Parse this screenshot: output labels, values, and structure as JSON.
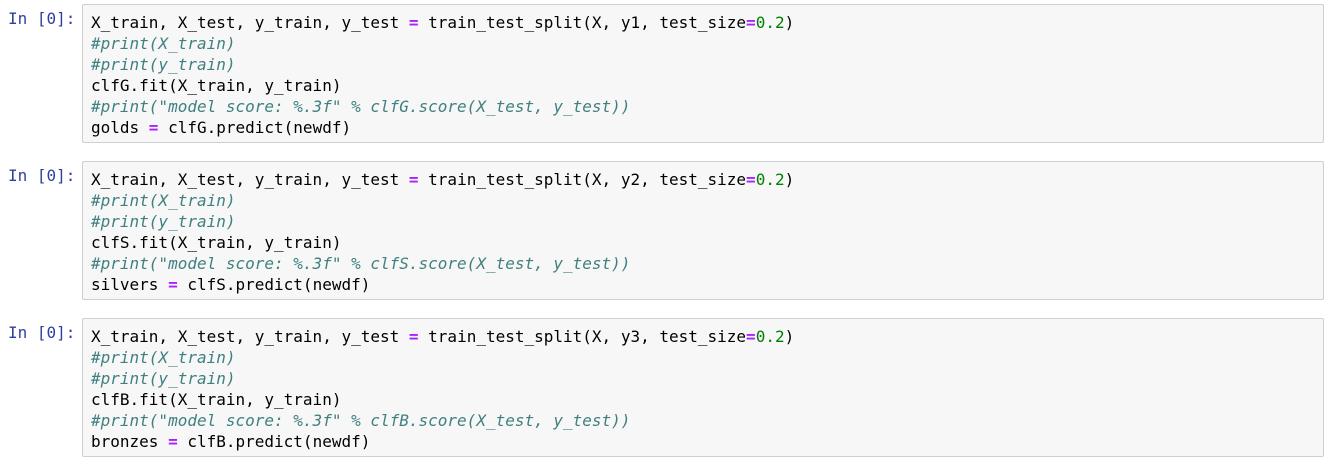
{
  "colors": {
    "prompt": "#303F9F",
    "operator": "#AA22FF",
    "number": "#008000",
    "comment": "#408080",
    "cell_background": "#f7f7f7",
    "cell_border": "#cfcfcf"
  },
  "cells": [
    {
      "prompt": "In [0]:",
      "lines": [
        [
          {
            "t": "plain",
            "text": "X_train, X_test, y_train, y_test "
          },
          {
            "t": "op",
            "text": "="
          },
          {
            "t": "plain",
            "text": " train_test_split(X, y1, test_size"
          },
          {
            "t": "op",
            "text": "="
          },
          {
            "t": "num",
            "text": "0.2"
          },
          {
            "t": "plain",
            "text": ")"
          }
        ],
        [
          {
            "t": "comment",
            "text": "#print(X_train)"
          }
        ],
        [
          {
            "t": "comment",
            "text": "#print(y_train)"
          }
        ],
        [
          {
            "t": "plain",
            "text": "clfG.fit(X_train, y_train)"
          }
        ],
        [
          {
            "t": "comment",
            "text": "#print(\"model score: %.3f\" % clfG.score(X_test, y_test))"
          }
        ],
        [
          {
            "t": "plain",
            "text": "golds "
          },
          {
            "t": "op",
            "text": "="
          },
          {
            "t": "plain",
            "text": " clfG.predict(newdf)"
          }
        ]
      ]
    },
    {
      "prompt": "In [0]:",
      "lines": [
        [
          {
            "t": "plain",
            "text": "X_train, X_test, y_train, y_test "
          },
          {
            "t": "op",
            "text": "="
          },
          {
            "t": "plain",
            "text": " train_test_split(X, y2, test_size"
          },
          {
            "t": "op",
            "text": "="
          },
          {
            "t": "num",
            "text": "0.2"
          },
          {
            "t": "plain",
            "text": ")"
          }
        ],
        [
          {
            "t": "comment",
            "text": "#print(X_train)"
          }
        ],
        [
          {
            "t": "comment",
            "text": "#print(y_train)"
          }
        ],
        [
          {
            "t": "plain",
            "text": "clfS.fit(X_train, y_train)"
          }
        ],
        [
          {
            "t": "comment",
            "text": "#print(\"model score: %.3f\" % clfS.score(X_test, y_test))"
          }
        ],
        [
          {
            "t": "plain",
            "text": "silvers "
          },
          {
            "t": "op",
            "text": "="
          },
          {
            "t": "plain",
            "text": " clfS.predict(newdf)"
          }
        ]
      ]
    },
    {
      "prompt": "In [0]:",
      "lines": [
        [
          {
            "t": "plain",
            "text": "X_train, X_test, y_train, y_test "
          },
          {
            "t": "op",
            "text": "="
          },
          {
            "t": "plain",
            "text": " train_test_split(X, y3, test_size"
          },
          {
            "t": "op",
            "text": "="
          },
          {
            "t": "num",
            "text": "0.2"
          },
          {
            "t": "plain",
            "text": ")"
          }
        ],
        [
          {
            "t": "comment",
            "text": "#print(X_train)"
          }
        ],
        [
          {
            "t": "comment",
            "text": "#print(y_train)"
          }
        ],
        [
          {
            "t": "plain",
            "text": "clfB.fit(X_train, y_train)"
          }
        ],
        [
          {
            "t": "comment",
            "text": "#print(\"model score: %.3f\" % clfB.score(X_test, y_test))"
          }
        ],
        [
          {
            "t": "plain",
            "text": "bronzes "
          },
          {
            "t": "op",
            "text": "="
          },
          {
            "t": "plain",
            "text": " clfB.predict(newdf)"
          }
        ]
      ]
    }
  ]
}
